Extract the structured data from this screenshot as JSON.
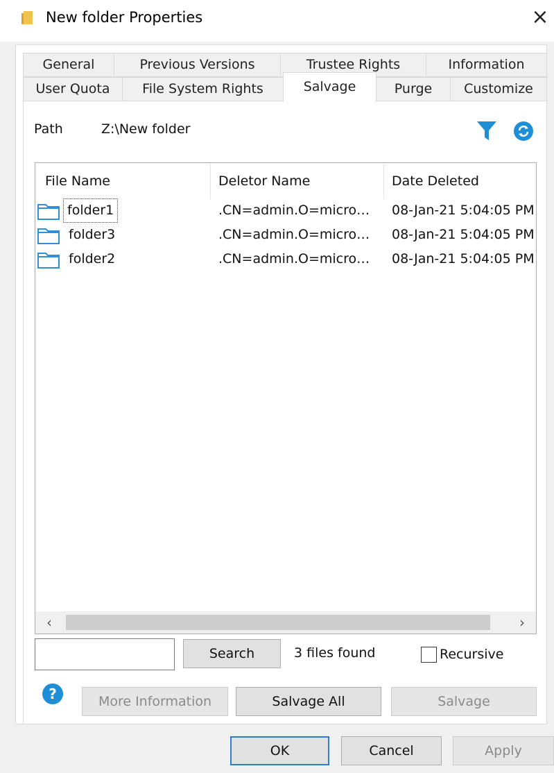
{
  "window": {
    "title": "New folder Properties",
    "close_glyph": "×"
  },
  "tabs": {
    "row1": [
      "General",
      "Previous Versions",
      "Trustee Rights",
      "Information"
    ],
    "row2": [
      "User Quota",
      "File System Rights",
      "Salvage",
      "Purge",
      "Customize"
    ],
    "active": "Salvage"
  },
  "path": {
    "label": "Path",
    "value": "Z:\\New folder"
  },
  "icons": {
    "filter": "filter-icon",
    "refresh": "refresh-icon",
    "help": "help-icon",
    "folder": "folder-icon"
  },
  "list": {
    "columns": [
      "File Name",
      "Deletor Name",
      "Date Deleted"
    ],
    "rows": [
      {
        "name": "folder1",
        "deletor": ".CN=admin.O=micro…",
        "date": "08-Jan-21 5:04:05 PM"
      },
      {
        "name": "folder3",
        "deletor": ".CN=admin.O=micro…",
        "date": "08-Jan-21 5:04:05 PM"
      },
      {
        "name": "folder2",
        "deletor": ".CN=admin.O=micro…",
        "date": "08-Jan-21 5:04:05 PM"
      }
    ],
    "scroll_left": "‹",
    "scroll_right": "›"
  },
  "search": {
    "value": "",
    "button": "Search",
    "status": "3 files found",
    "recursive_label": "Recursive",
    "recursive_checked": false
  },
  "actions": {
    "more_info": "More Information",
    "salvage_all": "Salvage All",
    "salvage": "Salvage"
  },
  "footer": {
    "ok": "OK",
    "cancel": "Cancel",
    "apply": "Apply"
  },
  "colors": {
    "accent": "#1e8fd6",
    "default_border": "#2f7ad6",
    "folder_outline": "#2f8fd8",
    "title_folder": "#e8b43a"
  }
}
